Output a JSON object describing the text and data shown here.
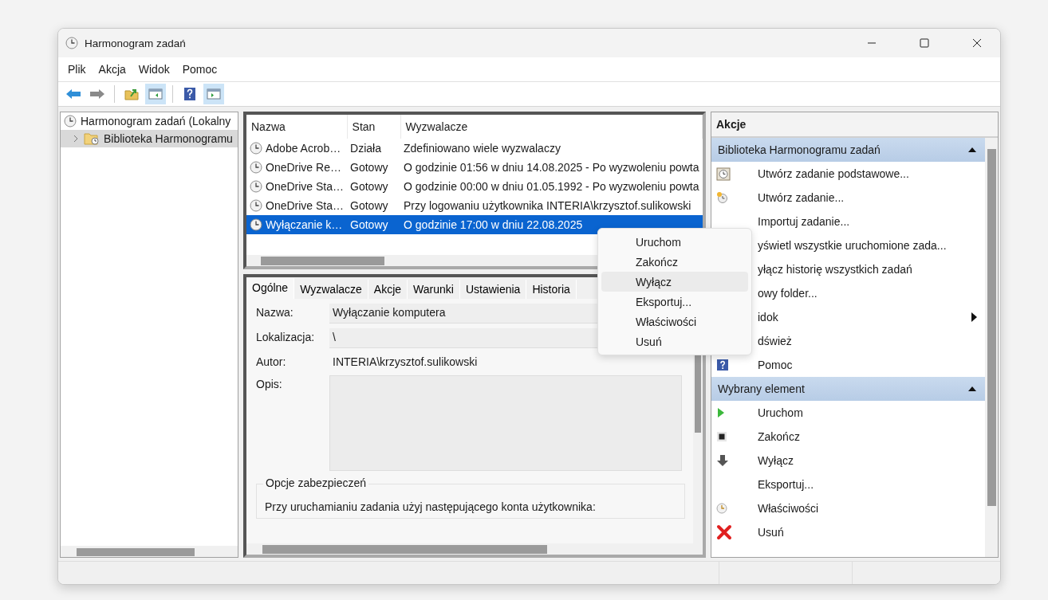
{
  "window": {
    "title": "Harmonogram zadań"
  },
  "menu_bar": [
    "Plik",
    "Akcja",
    "Widok",
    "Pomoc"
  ],
  "tree": [
    {
      "label": "Harmonogram zadań (Lokalny",
      "selected": false,
      "expanded": true,
      "children": [
        {
          "label": "Biblioteka Harmonogramu",
          "selected": true,
          "expanded": false
        }
      ]
    }
  ],
  "task_list": {
    "columns": [
      "Nazwa",
      "Stan",
      "Wyzwalacze"
    ],
    "rows": [
      {
        "name": "Adobe Acrob…",
        "status": "Działa",
        "trigger": "Zdefiniowano wiele wyzwalaczy",
        "selected": false
      },
      {
        "name": "OneDrive Re…",
        "status": "Gotowy",
        "trigger": "O godzinie 01:56 w dniu 14.08.2025 - Po wyzwoleniu powta",
        "selected": false
      },
      {
        "name": "OneDrive Sta…",
        "status": "Gotowy",
        "trigger": "O godzinie 00:00 w dniu 01.05.1992 - Po wyzwoleniu powta",
        "selected": false
      },
      {
        "name": "OneDrive Sta…",
        "status": "Gotowy",
        "trigger": "Przy logowaniu użytkownika INTERIA\\krzysztof.sulikowski",
        "selected": false
      },
      {
        "name": "Wyłączanie k…",
        "status": "Gotowy",
        "trigger": "O godzinie 17:00 w dniu 22.08.2025",
        "selected": true
      }
    ]
  },
  "details": {
    "tabs": [
      {
        "label": "Ogólne",
        "selected": true
      },
      {
        "label": "Wyzwalacze",
        "selected": false
      },
      {
        "label": "Akcje",
        "selected": false
      },
      {
        "label": "Warunki",
        "selected": false
      },
      {
        "label": "Ustawienia",
        "selected": false
      },
      {
        "label": "Historia",
        "selected": false
      }
    ],
    "name_label": "Nazwa:",
    "name_value": "Wyłączanie komputera",
    "location_label": "Lokalizacja:",
    "location_value": "\\",
    "author_label": "Autor:",
    "author_value": "INTERIA\\krzysztof.sulikowski",
    "description_label": "Opis:",
    "security_title": "Opcje zabezpieczeń",
    "security_text": "Przy uruchamianiu zadania użyj następującego konta użytkownika:"
  },
  "context_menu": [
    {
      "label": "Uruchom",
      "highlighted": false
    },
    {
      "label": "Zakończ",
      "highlighted": false
    },
    {
      "label": "Wyłącz",
      "highlighted": true
    },
    {
      "label": "Eksportuj...",
      "highlighted": false
    },
    {
      "label": "Właściwości",
      "highlighted": false
    },
    {
      "label": "Usuń",
      "highlighted": false
    }
  ],
  "actions": {
    "title": "Akcje",
    "sections": [
      {
        "title": "Biblioteka Harmonogramu zadań",
        "expanded": true,
        "items": [
          {
            "label": "Utwórz zadanie podstawowe...",
            "kind": "basic-task"
          },
          {
            "label": "Utwórz zadanie...",
            "kind": "task"
          },
          {
            "label": "Importuj zadanie...",
            "kind": "none"
          },
          {
            "label": "yświetl wszystkie uruchomione zada...",
            "kind": "none"
          },
          {
            "label": "yłącz historię wszystkich zadań",
            "kind": "none"
          },
          {
            "label": "owy folder...",
            "kind": "none"
          },
          {
            "label": "idok",
            "kind": "none",
            "submenu": true
          },
          {
            "label": "dśwież",
            "kind": "none"
          },
          {
            "label": "Pomoc",
            "kind": "help"
          }
        ]
      },
      {
        "title": "Wybrany element",
        "expanded": true,
        "items": [
          {
            "label": "Uruchom",
            "kind": "run"
          },
          {
            "label": "Zakończ",
            "kind": "stop"
          },
          {
            "label": "Wyłącz",
            "kind": "disable"
          },
          {
            "label": "Eksportuj...",
            "kind": "none"
          },
          {
            "label": "Właściwości",
            "kind": "properties"
          },
          {
            "label": "Usuń",
            "kind": "delete"
          }
        ]
      }
    ]
  }
}
